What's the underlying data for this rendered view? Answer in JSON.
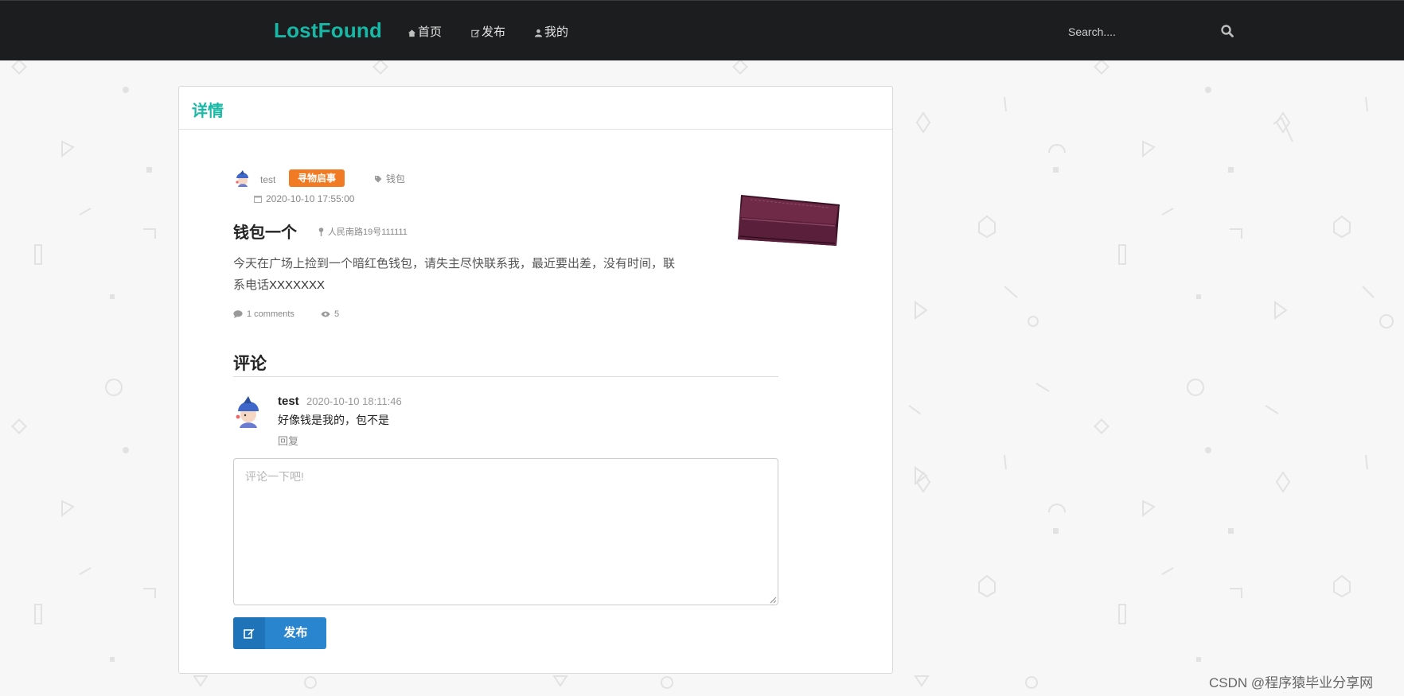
{
  "navbar": {
    "brand": "LostFound",
    "items": [
      {
        "label": "首页",
        "icon": "home-icon"
      },
      {
        "label": "发布",
        "icon": "edit-icon"
      },
      {
        "label": "我的",
        "icon": "user-icon"
      }
    ],
    "search": {
      "placeholder": "Search....",
      "icon": "search-icon"
    }
  },
  "panel": {
    "title": "详情"
  },
  "post": {
    "author": "test",
    "badge": "寻物启事",
    "tag": "钱包",
    "date": "2020-10-10 17:55:00",
    "title": "钱包一个",
    "location": "人民南路19号111111",
    "body": "今天在广场上捡到一个暗红色钱包，请失主尽快联系我，最近要出差，没有时间，联系电话",
    "phone": "XXXXXXX",
    "comments_count": "1 comments",
    "views": "5"
  },
  "comments": {
    "title": "评论",
    "items": [
      {
        "author": "test",
        "time": "2020-10-10 18:11:46",
        "text": "好像钱是我的，包不是",
        "reply": "回复"
      }
    ],
    "input_placeholder": "评论一下吧!",
    "submit_label": "发布"
  },
  "watermark": "CSDN @程序猿毕业分享网",
  "colors": {
    "brand": "#18b8a6",
    "navbar": "#1c1d1f",
    "badge": "#f07b24",
    "button": "#2a85cf"
  }
}
